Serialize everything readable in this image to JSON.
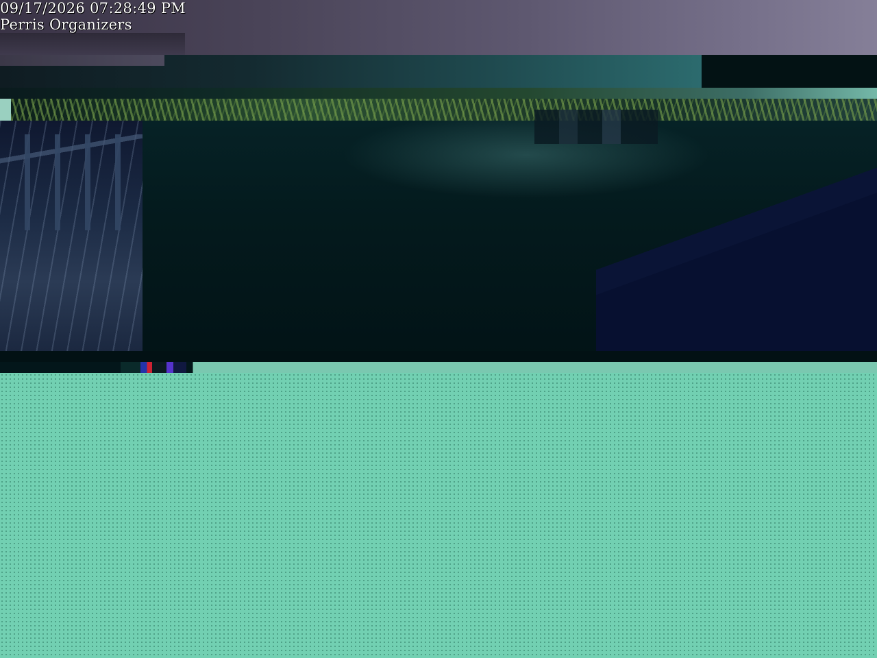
{
  "overlay": {
    "timestamp": "09/17/2026 07:28:49 PM",
    "camera_name": "Perris Organizers"
  }
}
